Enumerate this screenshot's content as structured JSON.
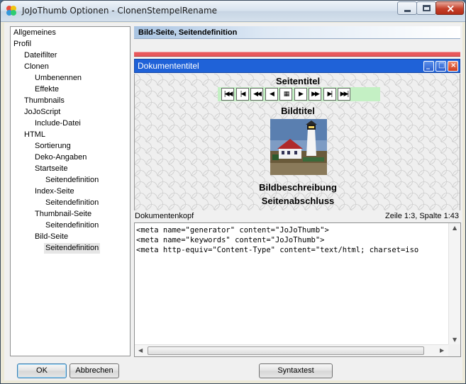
{
  "window": {
    "title": "JoJoThumb Optionen - ClonenStempelRename"
  },
  "tree": {
    "items": [
      {
        "label": "Allgemeines",
        "level": 0
      },
      {
        "label": "Profil",
        "level": 0
      },
      {
        "label": "Dateifilter",
        "level": 1
      },
      {
        "label": "Clonen",
        "level": 1
      },
      {
        "label": "Umbenennen",
        "level": 2
      },
      {
        "label": "Effekte",
        "level": 2
      },
      {
        "label": "Thumbnails",
        "level": 1
      },
      {
        "label": "JoJoScript",
        "level": 1
      },
      {
        "label": "Include-Datei",
        "level": 2
      },
      {
        "label": "HTML",
        "level": 1
      },
      {
        "label": "Sortierung",
        "level": 2
      },
      {
        "label": "Deko-Angaben",
        "level": 2
      },
      {
        "label": "Startseite",
        "level": 2
      },
      {
        "label": "Seitendefinition",
        "level": 3
      },
      {
        "label": "Index-Seite",
        "level": 2
      },
      {
        "label": "Seitendefinition",
        "level": 3
      },
      {
        "label": "Thumbnail-Seite",
        "level": 2
      },
      {
        "label": "Seitendefinition",
        "level": 3
      },
      {
        "label": "Bild-Seite",
        "level": 2
      },
      {
        "label": "Seitendefinition",
        "level": 3,
        "selected": true
      }
    ]
  },
  "main": {
    "header": "Bild-Seite, Seitendefinition",
    "preview": {
      "window_title": "Dokumententitel",
      "seitentitel": "Seitentitel",
      "bildtitel": "Bildtitel",
      "bildbeschreibung": "Bildbeschreibung",
      "seitenabschluss": "Seitenabschluss",
      "nav_icons": [
        "first-icon",
        "prev-group-icon",
        "prev-fast-icon",
        "prev-icon",
        "index-grid-icon",
        "next-icon",
        "next-fast-icon",
        "next-group-icon",
        "last-icon"
      ]
    },
    "editor": {
      "label": "Dokumentenkopf",
      "position": "Zeile 1:3, Spalte 1:43",
      "lines": [
        "<meta name=\"generator\" content=\"JoJoThumb\">",
        "<meta name=\"keywords\" content=\"JoJoThumb\">",
        "<meta http-equiv=\"Content-Type\" content=\"text/html; charset=iso"
      ]
    }
  },
  "buttons": {
    "ok": "OK",
    "cancel": "Abbrechen",
    "syntax": "Syntaxtest"
  },
  "colors": {
    "inner_titlebar": "#1f62d8",
    "red_bar": "#e8585c",
    "nav_bar": "#c4f0c4"
  }
}
